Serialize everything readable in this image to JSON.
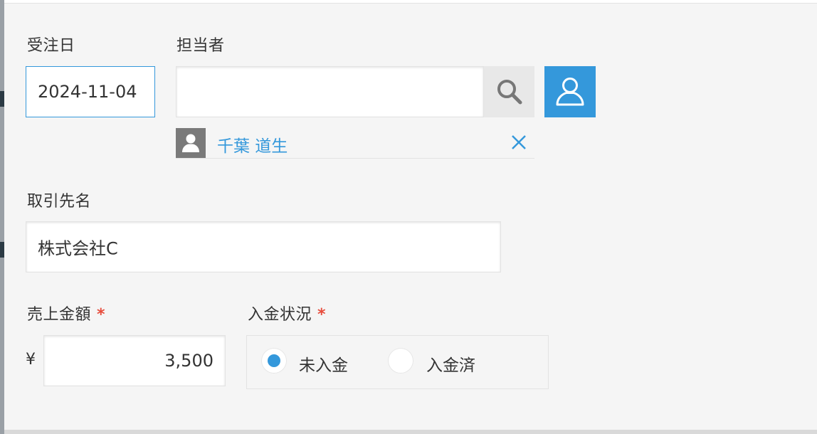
{
  "form": {
    "order_date": {
      "label": "受注日",
      "value": "2024-11-04"
    },
    "assignee": {
      "label": "担当者",
      "search_value": "",
      "selected_user": "千葉 道生"
    },
    "client_name": {
      "label": "取引先名",
      "value": "株式会社C"
    },
    "sales_amount": {
      "label": "売上金額",
      "required_mark": "*",
      "currency": "¥",
      "value": "3,500"
    },
    "payment_status": {
      "label": "入金状況",
      "required_mark": "*",
      "options": [
        {
          "label": "未入金",
          "selected": true
        },
        {
          "label": "入金済",
          "selected": false
        }
      ]
    }
  },
  "colors": {
    "accent": "#3498db",
    "required": "#e74c3c",
    "background": "#f5f5f5"
  },
  "icons": {
    "search": "magnifier-icon",
    "user_select": "person-outline-icon",
    "avatar": "person-silhouette-icon",
    "remove": "close-x-icon"
  }
}
